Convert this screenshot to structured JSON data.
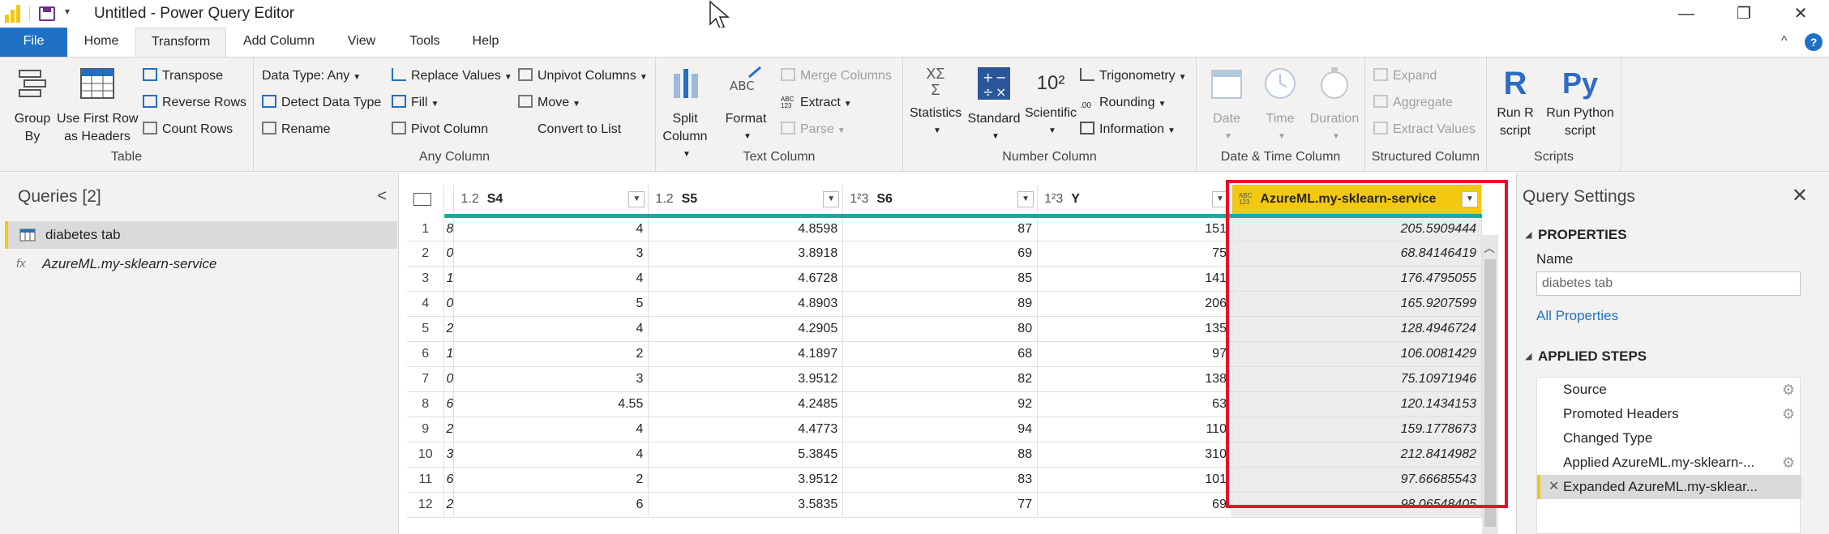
{
  "titlebar": {
    "quick_access": "▾",
    "title": "Untitled - Power Query Editor",
    "minimize": "—",
    "restore": "❐",
    "close": "✕"
  },
  "tabs": [
    "File",
    "Home",
    "Transform",
    "Add Column",
    "View",
    "Tools",
    "Help"
  ],
  "tabs_right": {
    "collapse": "^",
    "help": "?"
  },
  "ribbon": {
    "table": {
      "label": "Table",
      "group_by": "Group\nBy",
      "use_first_row": "Use First Row\nas Headers",
      "transpose": "Transpose",
      "reverse_rows": "Reverse Rows",
      "count_rows": "Count Rows"
    },
    "any_column": {
      "label": "Any Column",
      "data_type": "Data Type: Any",
      "detect_data_type": "Detect Data Type",
      "rename": "Rename",
      "replace_values": "Replace Values",
      "fill": "Fill",
      "pivot_column": "Pivot Column",
      "unpivot_columns": "Unpivot Columns",
      "move": "Move",
      "convert_to_list": "Convert to List"
    },
    "text_column": {
      "label": "Text Column",
      "split_column": "Split\nColumn",
      "format": "Format",
      "merge_columns": "Merge Columns",
      "extract": "Extract",
      "parse": "Parse",
      "format_icon_text": "ABC",
      "extract_icon_text": "ABC\n123"
    },
    "number_column": {
      "label": "Number Column",
      "statistics": "Statistics",
      "standard": "Standard",
      "scientific": "Scientific",
      "trigonometry": "Trigonometry",
      "rounding": "Rounding",
      "information": "Information",
      "stat_icon_text": "XΣ\nΣ",
      "sci_icon_text": "10²",
      "rounding_icon_text": ".00"
    },
    "date_time": {
      "label": "Date & Time Column",
      "date": "Date",
      "time": "Time",
      "duration": "Duration"
    },
    "structured": {
      "label": "Structured Column",
      "expand": "Expand",
      "aggregate": "Aggregate",
      "extract_values": "Extract Values"
    },
    "scripts": {
      "label": "Scripts",
      "run_r": "Run R\nscript",
      "run_python": "Run Python\nscript",
      "r_icon_text": "R",
      "py_icon_text": "Py"
    }
  },
  "queries": {
    "header": "Queries [2]",
    "collapse": "<",
    "items": [
      {
        "label": "diabetes tab",
        "selected": true,
        "icon": "table-icon"
      },
      {
        "label": "AzureML.my-sklearn-service",
        "selected": false,
        "icon": "fx-icon",
        "icon_text": "fx"
      }
    ]
  },
  "grid": {
    "columns": [
      {
        "type": "1.2",
        "name": "S4"
      },
      {
        "type": "1.2",
        "name": "S5"
      },
      {
        "type": "1²3",
        "name": "S6"
      },
      {
        "type": "1²3",
        "name": "Y"
      },
      {
        "type": "ABC\n123",
        "name": "AzureML.my-sklearn-service"
      }
    ],
    "rows": [
      {
        "n": "1",
        "cut": "8",
        "s4": "4",
        "s5": "4.8598",
        "s6": "87",
        "y": "151",
        "az": "205.5909444"
      },
      {
        "n": "2",
        "cut": "0",
        "s4": "3",
        "s5": "3.8918",
        "s6": "69",
        "y": "75",
        "az": "68.84146419"
      },
      {
        "n": "3",
        "cut": "1",
        "s4": "4",
        "s5": "4.6728",
        "s6": "85",
        "y": "141",
        "az": "176.4795055"
      },
      {
        "n": "4",
        "cut": "0",
        "s4": "5",
        "s5": "4.8903",
        "s6": "89",
        "y": "206",
        "az": "165.9207599"
      },
      {
        "n": "5",
        "cut": "2",
        "s4": "4",
        "s5": "4.2905",
        "s6": "80",
        "y": "135",
        "az": "128.4946724"
      },
      {
        "n": "6",
        "cut": "1",
        "s4": "2",
        "s5": "4.1897",
        "s6": "68",
        "y": "97",
        "az": "106.0081429"
      },
      {
        "n": "7",
        "cut": "0",
        "s4": "3",
        "s5": "3.9512",
        "s6": "82",
        "y": "138",
        "az": "75.10971946"
      },
      {
        "n": "8",
        "cut": "6",
        "s4": "4.55",
        "s5": "4.2485",
        "s6": "92",
        "y": "63",
        "az": "120.1434153"
      },
      {
        "n": "9",
        "cut": "2",
        "s4": "4",
        "s5": "4.4773",
        "s6": "94",
        "y": "110",
        "az": "159.1778673"
      },
      {
        "n": "10",
        "cut": "3",
        "s4": "4",
        "s5": "5.3845",
        "s6": "88",
        "y": "310",
        "az": "212.8414982"
      },
      {
        "n": "11",
        "cut": "6",
        "s4": "2",
        "s5": "3.9512",
        "s6": "83",
        "y": "101",
        "az": "97.66685543"
      },
      {
        "n": "12",
        "cut": "2",
        "s4": "6",
        "s5": "3.5835",
        "s6": "77",
        "y": "69",
        "az": "98.06548405"
      }
    ]
  },
  "settings": {
    "title": "Query Settings",
    "close": "✕",
    "properties": "PROPERTIES",
    "name_label": "Name",
    "name_value": "diabetes tab",
    "all_properties": "All Properties",
    "applied_steps": "APPLIED STEPS",
    "steps": [
      {
        "label": "Source",
        "gear": true
      },
      {
        "label": "Promoted Headers",
        "gear": true
      },
      {
        "label": "Changed Type",
        "gear": false
      },
      {
        "label": "Applied AzureML.my-sklearn-...",
        "gear": true
      },
      {
        "label": "Expanded AzureML.my-sklear...",
        "gear": false,
        "selected": true,
        "delete": "✕"
      }
    ]
  },
  "colors": {
    "accent": "#1f71c6",
    "highlight": "#f2c811",
    "teal": "#1fa99e",
    "redbox": "#e81123"
  }
}
